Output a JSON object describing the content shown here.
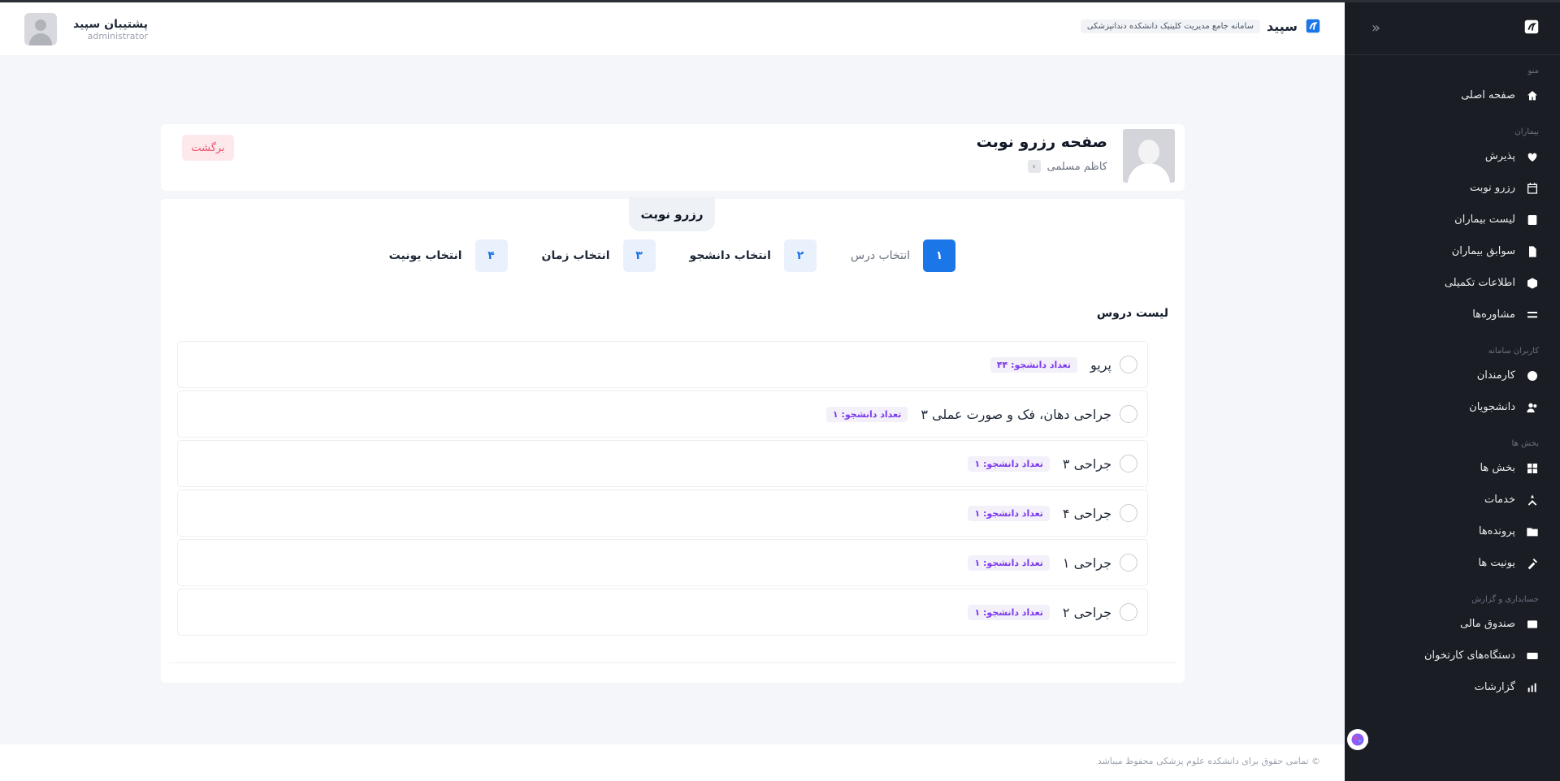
{
  "header": {
    "brand_name": "سپید",
    "brand_subtitle": "سامانه جامع مدیریت کلینیک دانشکده دندانپزشکی",
    "user_name": "پشتیبان سپید",
    "user_role": "administrator"
  },
  "sidebar": {
    "sections": [
      {
        "title": "منو",
        "items": [
          {
            "label": "صفحه اصلی",
            "icon": "home-icon"
          }
        ]
      },
      {
        "title": "بیماران",
        "items": [
          {
            "label": "پذیرش",
            "icon": "heartbeat-icon"
          },
          {
            "label": "رزرو نوبت",
            "icon": "calendar-icon"
          },
          {
            "label": "لیست بیماران",
            "icon": "contacts-icon"
          },
          {
            "label": "سوابق بیماران",
            "icon": "document-icon"
          },
          {
            "label": "اطلاعات تکمیلی",
            "icon": "cube-icon"
          },
          {
            "label": "مشاوره‌ها",
            "icon": "bars-icon"
          }
        ]
      },
      {
        "title": "کاربران سامانه",
        "items": [
          {
            "label": "کارمندان",
            "icon": "user-circle-icon"
          },
          {
            "label": "دانشجویان",
            "icon": "users-icon"
          }
        ]
      },
      {
        "title": "بخش ها",
        "items": [
          {
            "label": "بخش ها",
            "icon": "grid-icon"
          },
          {
            "label": "خدمات",
            "icon": "tools-icon"
          },
          {
            "label": "پرونده‌ها",
            "icon": "folder-icon"
          },
          {
            "label": "یونیت ها",
            "icon": "syringe-icon"
          }
        ]
      },
      {
        "title": "حسابداری و گزارش",
        "items": [
          {
            "label": "صندوق مالی",
            "icon": "cashbox-icon"
          },
          {
            "label": "دستگاه‌های کارتخوان",
            "icon": "card-icon"
          },
          {
            "label": "گزارشات",
            "icon": "report-icon"
          }
        ]
      }
    ]
  },
  "page": {
    "title": "صفحه رزرو نوبت",
    "patient_name": "کاظم مسلمی",
    "back_label": "برگشت"
  },
  "main": {
    "tab_label": "رزرو نوبت",
    "steps": [
      {
        "num": "۱",
        "label": "انتخاب درس"
      },
      {
        "num": "۲",
        "label": "انتخاب دانشجو"
      },
      {
        "num": "۳",
        "label": "انتخاب زمان"
      },
      {
        "num": "۴",
        "label": "انتخاب یونیت"
      }
    ],
    "list_title": "لیست دروس",
    "courses": [
      {
        "name": "پریو",
        "badge": "تعداد دانشجو: ۴۴"
      },
      {
        "name": "جراحی دهان، فک و صورت عملی ۳",
        "badge": "تعداد دانشجو: ۱"
      },
      {
        "name": "جراحی ۳",
        "badge": "تعداد دانشجو: ۱"
      },
      {
        "name": "جراحی ۴",
        "badge": "تعداد دانشجو: ۱"
      },
      {
        "name": "جراحی ۱",
        "badge": "تعداد دانشجو: ۱"
      },
      {
        "name": "جراحی ۲",
        "badge": "تعداد دانشجو: ۱"
      }
    ]
  },
  "footer": {
    "text": "© تمامی حقوق برای دانشکده علوم پزشکی محفوظ میباشد"
  },
  "colors": {
    "primary": "#1b76e8",
    "sidebar_bg": "#1a1d23",
    "badge_text": "#7c3aed",
    "back_text": "#ef4f6a"
  }
}
